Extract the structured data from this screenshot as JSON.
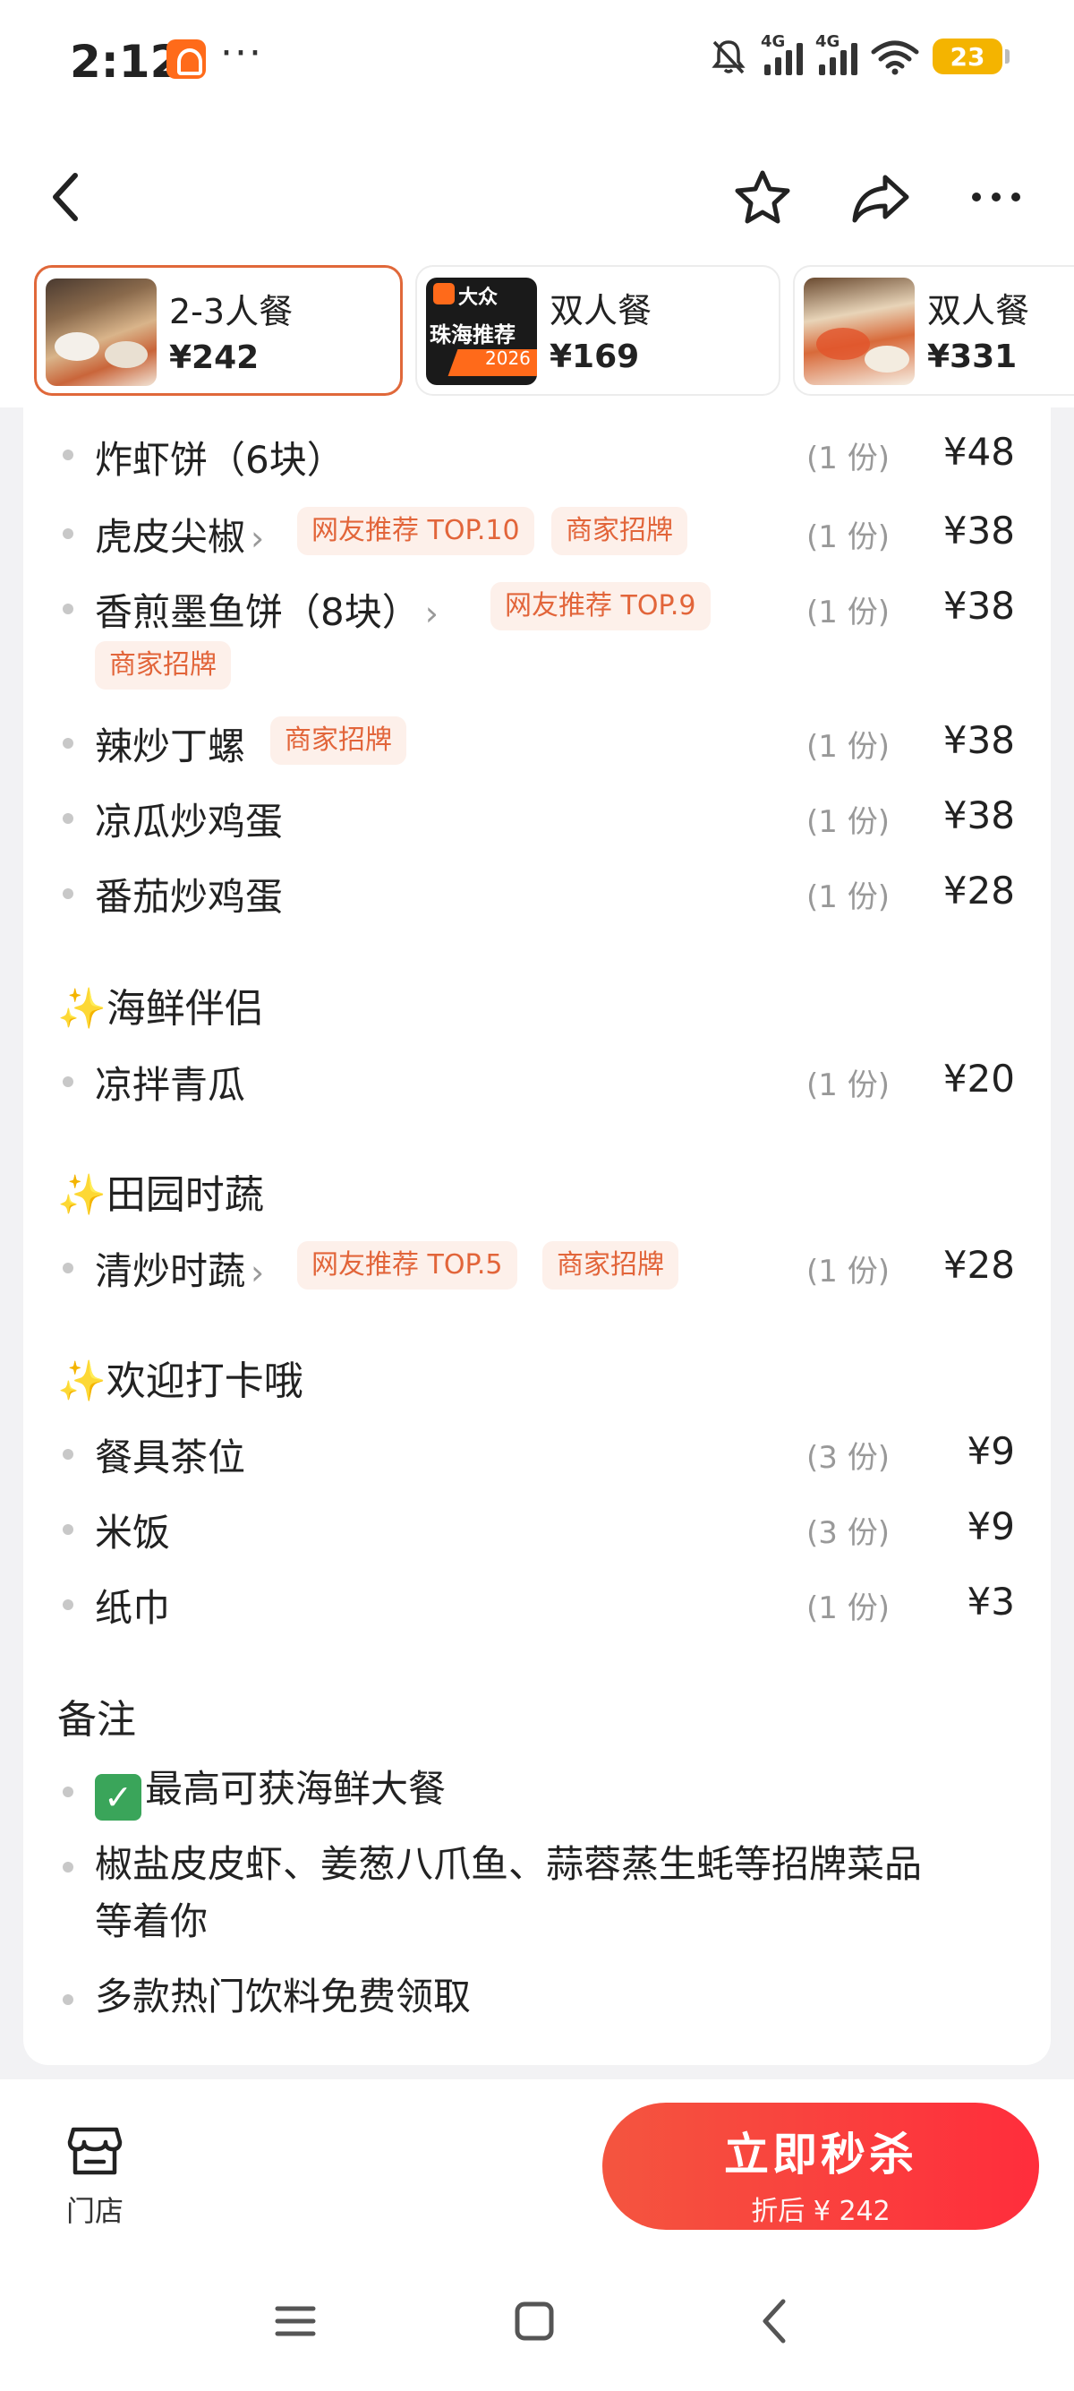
{
  "status_bar": {
    "time": "2:12",
    "dots": "···",
    "signal1_label": "4G",
    "signal2_label": "4G",
    "battery": "23"
  },
  "header": {
    "back_icon": "back-arrow-icon",
    "star_icon": "star-icon",
    "share_icon": "share-icon",
    "more_icon": "more-icon"
  },
  "tabs": [
    {
      "name": "2-3人餐",
      "price": "¥242"
    },
    {
      "name": "双人餐",
      "price": "¥169",
      "thumb_text": "大众",
      "thumb_text2": "珠海推荐",
      "thumb_year": "2026"
    },
    {
      "name": "双人餐",
      "price": "¥331"
    }
  ],
  "menu": {
    "partial_row": {
      "name": "炸虾饼（6块）",
      "qty": "(1 份)",
      "price": "¥48"
    },
    "rows": [
      {
        "name": "虎皮尖椒",
        "tags": [
          "网友推荐 TOP.10",
          "商家招牌"
        ],
        "qty": "(1 份)",
        "price": "¥38"
      },
      {
        "name": "香煎墨鱼饼（8块）",
        "tags": [
          "网友推荐 TOP.9",
          "商家招牌"
        ],
        "qty": "(1 份)",
        "price": "¥38"
      },
      {
        "name": "辣炒丁螺",
        "tags": [
          "商家招牌"
        ],
        "qty": "(1 份)",
        "price": "¥38"
      },
      {
        "name": "凉瓜炒鸡蛋",
        "qty": "(1 份)",
        "price": "¥38"
      },
      {
        "name": "番茄炒鸡蛋",
        "qty": "(1 份)",
        "price": "¥28"
      }
    ],
    "section_seafood": "海鲜伴侣",
    "seafood_rows": [
      {
        "name": "凉拌青瓜",
        "qty": "(1 份)",
        "price": "¥20"
      }
    ],
    "section_veg": "田园时蔬",
    "veg_rows": [
      {
        "name": "清炒时蔬",
        "tags": [
          "网友推荐 TOP.5",
          "商家招牌"
        ],
        "qty": "(1 份)",
        "price": "¥28"
      }
    ],
    "section_welcome": "欢迎打卡哦",
    "welcome_rows": [
      {
        "name": "餐具茶位",
        "qty": "(3 份)",
        "price": "¥9"
      },
      {
        "name": "米饭",
        "qty": "(3 份)",
        "price": "¥9"
      },
      {
        "name": "纸巾",
        "qty": "(1 份)",
        "price": "¥3"
      }
    ],
    "sparkle": "✨"
  },
  "notes": {
    "title": "备注",
    "items": [
      "最高可获海鲜大餐",
      "椒盐皮皮虾、姜葱八爪鱼、蒜蓉蒸生蚝等招牌菜品",
      "等着你",
      "多款热门饮料免费领取"
    ]
  },
  "action_bar": {
    "store_label": "门店",
    "buy_label": "立即秒杀",
    "buy_sub": "折后 ¥ 242"
  },
  "colors": {
    "accent": "#e2653a",
    "tag_bg": "#fdf0ea",
    "buy_start": "#f4553f",
    "buy_end": "#ff2d3c",
    "battery": "#f4b400"
  }
}
